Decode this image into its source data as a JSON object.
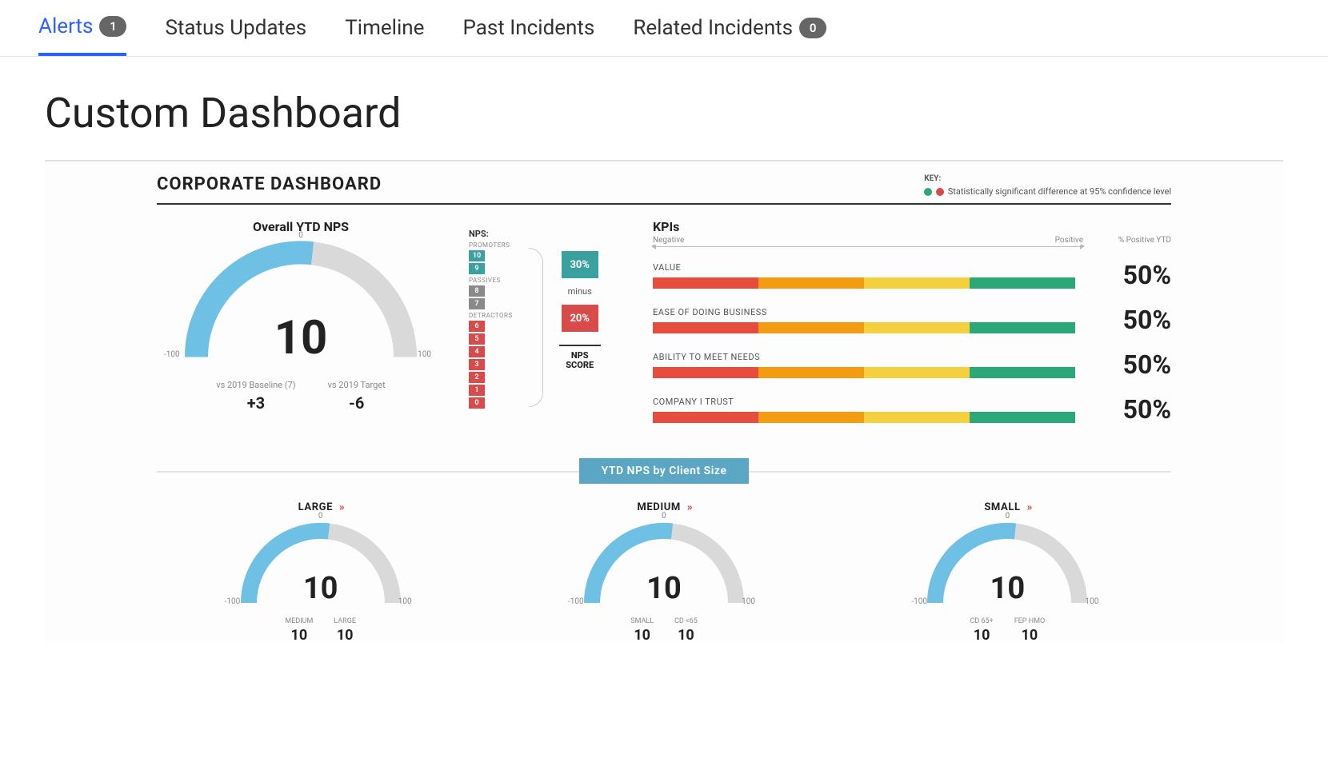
{
  "tabs": [
    {
      "label": "Alerts",
      "badge": "1",
      "active": true
    },
    {
      "label": "Status Updates"
    },
    {
      "label": "Timeline"
    },
    {
      "label": "Past Incidents"
    },
    {
      "label": "Related Incidents",
      "badge": "0"
    }
  ],
  "page_title": "Custom Dashboard",
  "corp_title": "CORPORATE DASHBOARD",
  "key": {
    "label": "KEY:",
    "text": "Statistically significant difference at 95% confidence level"
  },
  "overall": {
    "title": "Overall YTD NPS",
    "score": "10",
    "min": "-100",
    "max": "100",
    "zero": "0",
    "sub": [
      {
        "label": "vs 2019 Baseline (7)",
        "value": "+3"
      },
      {
        "label": "vs 2019 Target",
        "value": "-6"
      }
    ]
  },
  "nps_legend": {
    "heading": "NPS:",
    "promoters_label": "PROMOTERS",
    "promoters": [
      "10",
      "9"
    ],
    "passives_label": "PASSIVES",
    "passives": [
      "8",
      "7"
    ],
    "detractors_label": "DETRACTORS",
    "detractors": [
      "6",
      "5",
      "4",
      "3",
      "2",
      "1",
      "0"
    ],
    "promoters_pct": "30%",
    "minus_label": "minus",
    "detractors_pct": "20%",
    "score_label_1": "NPS",
    "score_label_2": "SCORE"
  },
  "kpis": {
    "title": "KPIs",
    "axis_neg": "Negative",
    "axis_pos": "Positive",
    "pct_head": "% Positive YTD",
    "rows": [
      {
        "name": "VALUE",
        "pct": "50%"
      },
      {
        "name": "EASE OF DOING BUSINESS",
        "pct": "50%"
      },
      {
        "name": "ABILITY TO MEET NEEDS",
        "pct": "50%"
      },
      {
        "name": "COMPANY I TRUST",
        "pct": "50%"
      }
    ]
  },
  "band": "YTD NPS by Client Size",
  "clients": [
    {
      "title": "LARGE",
      "score": "10",
      "sub": [
        {
          "label": "MEDIUM",
          "value": "10"
        },
        {
          "label": "LARGE",
          "value": "10"
        }
      ]
    },
    {
      "title": "MEDIUM",
      "score": "10",
      "sub": [
        {
          "label": "SMALL",
          "value": "10"
        },
        {
          "label": "CD <65",
          "value": "10"
        }
      ]
    },
    {
      "title": "SMALL",
      "score": "10",
      "sub": [
        {
          "label": "CD 65+",
          "value": "10"
        },
        {
          "label": "FEP HMO",
          "value": "10"
        }
      ]
    }
  ],
  "chart_data": {
    "gauges": {
      "type": "gauge",
      "range": [
        -100,
        100
      ],
      "overall": {
        "value": 10
      },
      "by_client_size": [
        {
          "name": "LARGE",
          "value": 10
        },
        {
          "name": "MEDIUM",
          "value": 10
        },
        {
          "name": "SMALL",
          "value": 10
        }
      ]
    },
    "kpi_bars": {
      "type": "bar",
      "unit": "% Positive YTD",
      "axis": {
        "negative": "Negative",
        "positive": "Positive"
      },
      "segments_pct": {
        "red": 25,
        "orange": 25,
        "yellow": 25,
        "teal": 25
      },
      "series": [
        {
          "name": "VALUE",
          "value": 50
        },
        {
          "name": "EASE OF DOING BUSINESS",
          "value": 50
        },
        {
          "name": "ABILITY TO MEET NEEDS",
          "value": 50
        },
        {
          "name": "COMPANY I TRUST",
          "value": 50
        }
      ]
    },
    "nps_calc": {
      "promoters_pct": 30,
      "detractors_pct": 20,
      "nps": 10
    }
  }
}
